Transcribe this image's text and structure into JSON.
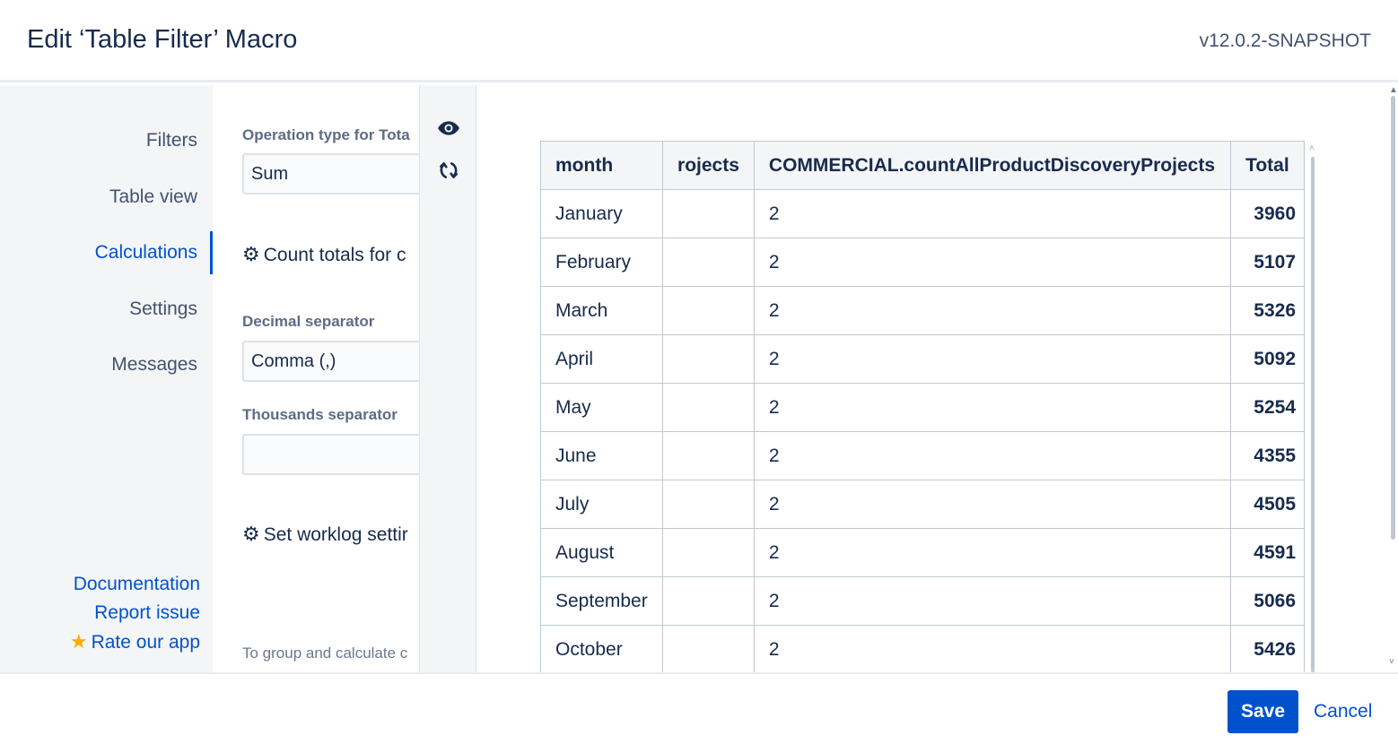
{
  "header": {
    "title": "Edit ‘Table Filter’ Macro",
    "version": "v12.0.2-SNAPSHOT"
  },
  "sidebar": {
    "items": [
      {
        "label": "Filters",
        "active": false
      },
      {
        "label": "Table view",
        "active": false
      },
      {
        "label": "Calculations",
        "active": true
      },
      {
        "label": "Settings",
        "active": false
      },
      {
        "label": "Messages",
        "active": false
      }
    ],
    "links": {
      "documentation": "Documentation",
      "report_issue": "Report issue",
      "rate_app": "Rate our app"
    }
  },
  "settings": {
    "operation_label": "Operation type for Tota",
    "operation_value": "Sum",
    "count_totals": "Count totals for c",
    "decimal_label": "Decimal separator",
    "decimal_value": "Comma (,)",
    "thousands_label": "Thousands separator",
    "thousands_value": "",
    "worklog": "Set worklog settir",
    "hint": "To group and calculate c"
  },
  "toolbar": {
    "preview_icon": "eye-icon",
    "refresh_icon": "refresh-icon"
  },
  "table": {
    "headers": [
      "month",
      "rojects",
      "COMMERCIAL.countAllProductDiscoveryProjects",
      "Total"
    ],
    "rows": [
      [
        "January",
        "",
        "2",
        "3960"
      ],
      [
        "February",
        "",
        "2",
        "5107"
      ],
      [
        "March",
        "",
        "2",
        "5326"
      ],
      [
        "April",
        "",
        "2",
        "5092"
      ],
      [
        "May",
        "",
        "2",
        "5254"
      ],
      [
        "June",
        "",
        "2",
        "4355"
      ],
      [
        "July",
        "",
        "2",
        "4505"
      ],
      [
        "August",
        "",
        "2",
        "4591"
      ],
      [
        "September",
        "",
        "2",
        "5066"
      ],
      [
        "October",
        "",
        "2",
        "5426"
      ]
    ]
  },
  "footer": {
    "save": "Save",
    "cancel": "Cancel"
  },
  "colors": {
    "accent": "#0052cc",
    "text": "#172b4d",
    "star": "#ffab00"
  }
}
